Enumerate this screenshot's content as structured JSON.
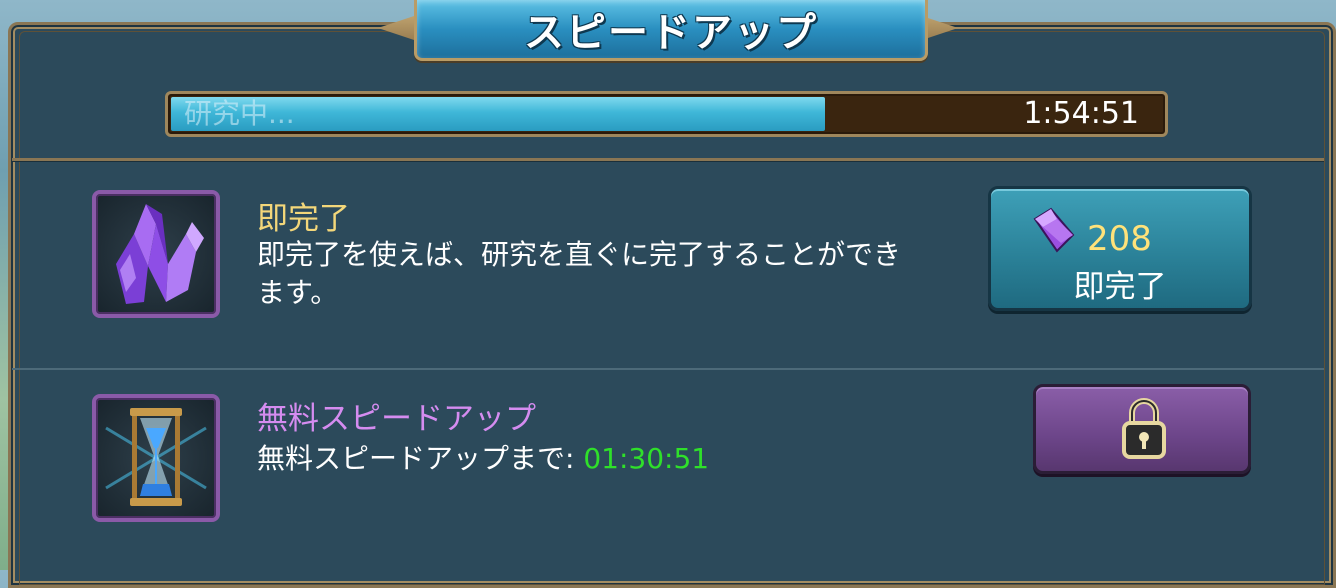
{
  "title": "スピードアップ",
  "progress": {
    "label": "研究中...",
    "time_remaining": "1:54:51",
    "fill_fraction": 0.66
  },
  "instant_complete": {
    "title": "即完了",
    "title_color": "#f3d77a",
    "description_line1": "即完了を使えば、研究を直ぐに完了することができ",
    "description_line2": "ます。",
    "icon": "purple-crystal-icon",
    "button": {
      "cost": "208",
      "cost_icon": "gem-icon",
      "label": "即完了"
    }
  },
  "free_speedup": {
    "title": "無料スピードアップ",
    "title_color": "#d58cf0",
    "description_prefix": "無料スピードアップまで: ",
    "countdown": "01:30:51",
    "icon": "hourglass-icon",
    "button_icon": "lock-icon"
  }
}
